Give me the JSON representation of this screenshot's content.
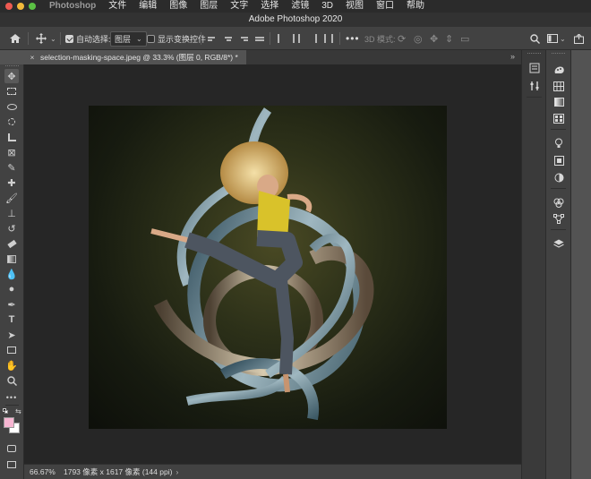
{
  "menubar": {
    "app_name": "Photoshop",
    "items": [
      "文件",
      "编辑",
      "图像",
      "图层",
      "文字",
      "选择",
      "滤镜",
      "3D",
      "视图",
      "窗口",
      "帮助"
    ]
  },
  "window": {
    "title": "Adobe Photoshop 2020"
  },
  "options_bar": {
    "auto_select_label": "自动选择:",
    "auto_select_checked": true,
    "auto_select_target": "图层",
    "show_transform_label": "显示变换控件",
    "show_transform_checked": false,
    "mode_3d_label": "3D 模式:"
  },
  "document_tab": {
    "title": "selection-masking-space.jpeg @ 33.3% (图层 0, RGB/8*) *"
  },
  "status_bar": {
    "zoom": "66.67%",
    "doc_info": "1793 像素 x 1617 像素 (144 ppi)"
  },
  "colors": {
    "foreground": "#f7b6d2",
    "background": "#ffffff",
    "ui_dark": "#424242",
    "canvas_bg": "#262626"
  },
  "tools": [
    "move-tool",
    "marquee-tool",
    "lasso-tool",
    "quick-select-tool",
    "crop-tool",
    "frame-tool",
    "eyedropper-tool",
    "spot-heal-tool",
    "brush-tool",
    "clone-stamp-tool",
    "history-brush-tool",
    "eraser-tool",
    "gradient-tool",
    "blur-tool",
    "dodge-tool",
    "pen-tool",
    "type-tool",
    "path-select-tool",
    "rectangle-tool",
    "hand-tool",
    "zoom-tool",
    "more-tools"
  ],
  "dock": {
    "col1": [
      "history-panel-icon",
      "properties-panel-icon"
    ],
    "col2": [
      "color-panel-icon",
      "swatches-panel-icon",
      "gradients-panel-icon",
      "patterns-panel-icon",
      "lights-panel-icon",
      "adjustments-panel-icon",
      "styles-panel-icon",
      "channels-panel-icon",
      "paths-panel-icon",
      "layers-panel-icon"
    ]
  }
}
